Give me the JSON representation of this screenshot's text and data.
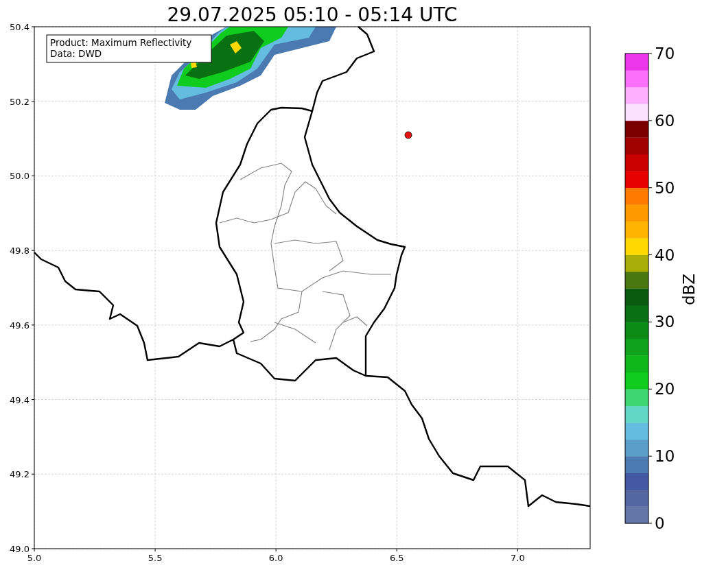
{
  "figure": {
    "title": "29.07.2025 05:10 - 05:14 UTC"
  },
  "map": {
    "info_box": [
      "Product: Maximum Reflectivity",
      "Data: DWD"
    ],
    "x_ticks": [
      "5.0",
      "5.5",
      "6.0",
      "6.5",
      "7.0"
    ],
    "y_ticks": [
      "50.4",
      "50.2",
      "50.0",
      "49.8",
      "49.6",
      "49.4",
      "49.2",
      "49.0"
    ]
  },
  "colorbar": {
    "label": "dBZ",
    "ticks": [
      "70",
      "60",
      "50",
      "40",
      "30",
      "20",
      "10",
      "0"
    ],
    "segments": [
      {
        "color": "#6475a8"
      },
      {
        "color": "#5467a0"
      },
      {
        "color": "#4258a0"
      },
      {
        "color": "#4a7ab0"
      },
      {
        "color": "#5b9ec8"
      },
      {
        "color": "#64bde0"
      },
      {
        "color": "#62d6c6"
      },
      {
        "color": "#3ed672"
      },
      {
        "color": "#10cc1e"
      },
      {
        "color": "#0fb81a"
      },
      {
        "color": "#0da21a"
      },
      {
        "color": "#0b8a14"
      },
      {
        "color": "#0a7112"
      },
      {
        "color": "#0a5a10"
      },
      {
        "color": "#4a7810"
      },
      {
        "color": "#aaae08"
      },
      {
        "color": "#fed800"
      },
      {
        "color": "#feb400"
      },
      {
        "color": "#fe9a00"
      },
      {
        "color": "#fe7a00"
      },
      {
        "color": "#e80000"
      },
      {
        "color": "#c80000"
      },
      {
        "color": "#a00000"
      },
      {
        "color": "#7c0000"
      },
      {
        "color": "#fde0fd"
      },
      {
        "color": "#fdb0fd"
      },
      {
        "color": "#fb70fb"
      },
      {
        "color": "#ec36ec"
      }
    ]
  }
}
